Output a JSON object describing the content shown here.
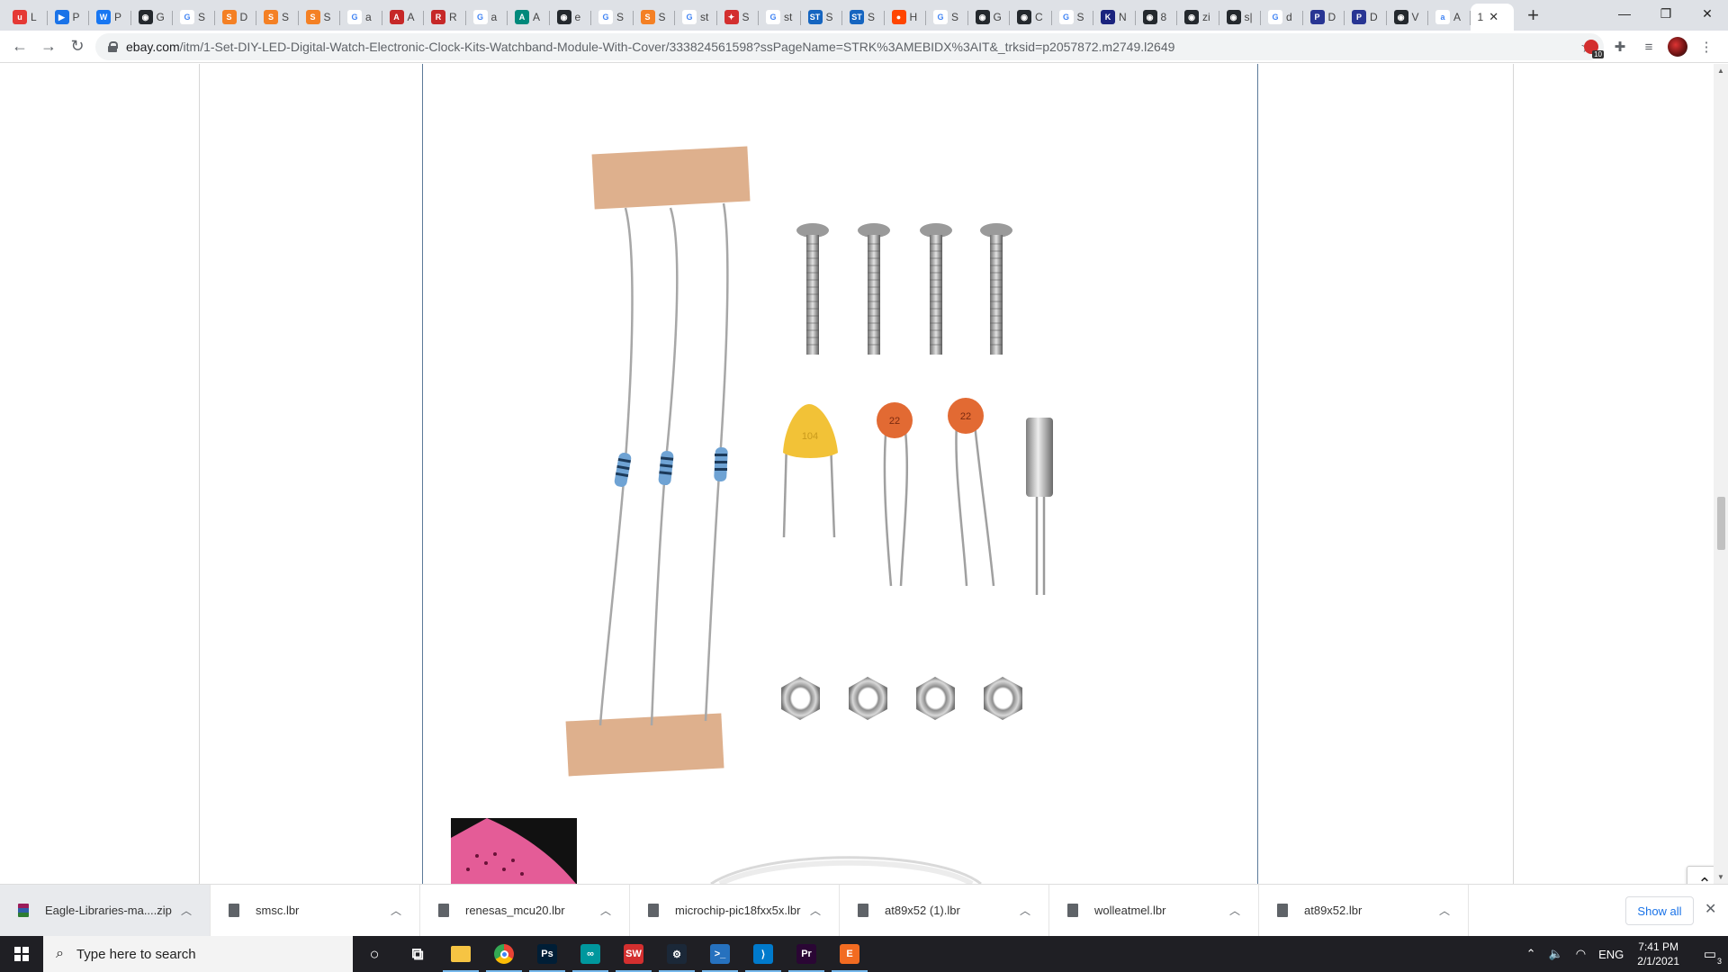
{
  "tabs": [
    {
      "label": "L",
      "color": "#e53935",
      "glyph": "u"
    },
    {
      "label": "P",
      "color": "#1a73e8",
      "glyph": "▶"
    },
    {
      "label": "P",
      "color": "#1877f2",
      "glyph": "W"
    },
    {
      "label": "G",
      "color": "#24292e",
      "glyph": "◉"
    },
    {
      "label": "S",
      "color": "#ffffff",
      "glyph": "G"
    },
    {
      "label": "D",
      "color": "#f48024",
      "glyph": "S"
    },
    {
      "label": "S",
      "color": "#f48024",
      "glyph": "S"
    },
    {
      "label": "S",
      "color": "#f48024",
      "glyph": "S"
    },
    {
      "label": "a",
      "color": "#ffffff",
      "glyph": "G"
    },
    {
      "label": "A",
      "color": "#c62828",
      "glyph": "A"
    },
    {
      "label": "R",
      "color": "#c62828",
      "glyph": "R"
    },
    {
      "label": "a",
      "color": "#ffffff",
      "glyph": "G"
    },
    {
      "label": "A",
      "color": "#00897b",
      "glyph": "A"
    },
    {
      "label": "e",
      "color": "#24292e",
      "glyph": "◉"
    },
    {
      "label": "S",
      "color": "#ffffff",
      "glyph": "G"
    },
    {
      "label": "S",
      "color": "#f48024",
      "glyph": "S"
    },
    {
      "label": "st",
      "color": "#ffffff",
      "glyph": "G"
    },
    {
      "label": "S",
      "color": "#d32f2f",
      "glyph": "✦"
    },
    {
      "label": "st",
      "color": "#ffffff",
      "glyph": "G"
    },
    {
      "label": "S",
      "color": "#1565c0",
      "glyph": "ST"
    },
    {
      "label": "S",
      "color": "#1565c0",
      "glyph": "ST"
    },
    {
      "label": "H",
      "color": "#ff4500",
      "glyph": "●"
    },
    {
      "label": "S",
      "color": "#ffffff",
      "glyph": "G"
    },
    {
      "label": "G",
      "color": "#24292e",
      "glyph": "◉"
    },
    {
      "label": "C",
      "color": "#24292e",
      "glyph": "◉"
    },
    {
      "label": "S",
      "color": "#ffffff",
      "glyph": "G"
    },
    {
      "label": "N",
      "color": "#1a237e",
      "glyph": "K"
    },
    {
      "label": "8",
      "color": "#24292e",
      "glyph": "◉"
    },
    {
      "label": "zi",
      "color": "#24292e",
      "glyph": "◉"
    },
    {
      "label": "s|",
      "color": "#24292e",
      "glyph": "◉"
    },
    {
      "label": "d",
      "color": "#ffffff",
      "glyph": "G"
    },
    {
      "label": "D",
      "color": "#283593",
      "glyph": "P"
    },
    {
      "label": "D",
      "color": "#283593",
      "glyph": "P"
    },
    {
      "label": "V",
      "color": "#24292e",
      "glyph": "◉"
    },
    {
      "label": "A",
      "color": "#ffffff",
      "glyph": "a"
    }
  ],
  "active_tab": {
    "label": "1",
    "close": "✕"
  },
  "newtab": "+",
  "window": {
    "minimize": "—",
    "restore": "❐",
    "close": "✕"
  },
  "nav": {
    "back": "←",
    "forward": "→",
    "reload": "↻"
  },
  "address": {
    "domain": "ebay.com",
    "path": "/itm/1-Set-DIY-LED-Digital-Watch-Electronic-Clock-Kits-Watchband-Module-With-Cover/333824561598?ssPageName=STRK%3AMEBIDX%3AIT&_trksid=p2057872.m2749.l2649",
    "star": "☆"
  },
  "extensions": {
    "badge": "10"
  },
  "product_image": {
    "capacitor_labels": [
      "104",
      "22",
      "22"
    ]
  },
  "back_to_top": "⌃",
  "downloads": [
    {
      "name": "Eagle-Libraries-ma....zip",
      "type": "zip"
    },
    {
      "name": "smsc.lbr",
      "type": "file"
    },
    {
      "name": "renesas_mcu20.lbr",
      "type": "file"
    },
    {
      "name": "microchip-pic18fxx5x.lbr",
      "type": "file"
    },
    {
      "name": "at89x52 (1).lbr",
      "type": "file"
    },
    {
      "name": "wolleatmel.lbr",
      "type": "file"
    },
    {
      "name": "at89x52.lbr",
      "type": "file"
    }
  ],
  "downloads_show_all": "Show all",
  "downloads_close": "✕",
  "taskbar": {
    "search_placeholder": "Type here to search",
    "apps": [
      {
        "name": "cortana",
        "glyph": "○",
        "color": "transparent"
      },
      {
        "name": "task-view",
        "glyph": "⧉",
        "color": "transparent"
      },
      {
        "name": "file-explorer",
        "glyph": "",
        "color": "#f6c443"
      },
      {
        "name": "chrome",
        "glyph": "",
        "color": "#ea4335"
      },
      {
        "name": "photoshop",
        "glyph": "Ps",
        "color": "#001e36"
      },
      {
        "name": "arduino",
        "glyph": "∞",
        "color": "#00979d"
      },
      {
        "name": "solidworks",
        "glyph": "SW",
        "color": "#d32f2f"
      },
      {
        "name": "steam",
        "glyph": "⚙",
        "color": "#1b2838"
      },
      {
        "name": "powershell",
        "glyph": ">_",
        "color": "#2671be"
      },
      {
        "name": "vscode",
        "glyph": "⟩",
        "color": "#007acc"
      },
      {
        "name": "premiere",
        "glyph": "Pr",
        "color": "#2a0634"
      },
      {
        "name": "eagle",
        "glyph": "E",
        "color": "#f26b21"
      }
    ],
    "tray": {
      "language": "ENG",
      "time": "7:41 PM",
      "date": "2/1/2021",
      "notifications": "3"
    }
  },
  "colors": {
    "tabstrip": "#dee1e6",
    "product_border": "#5b7a99",
    "page_line": "#d6d6d6"
  }
}
